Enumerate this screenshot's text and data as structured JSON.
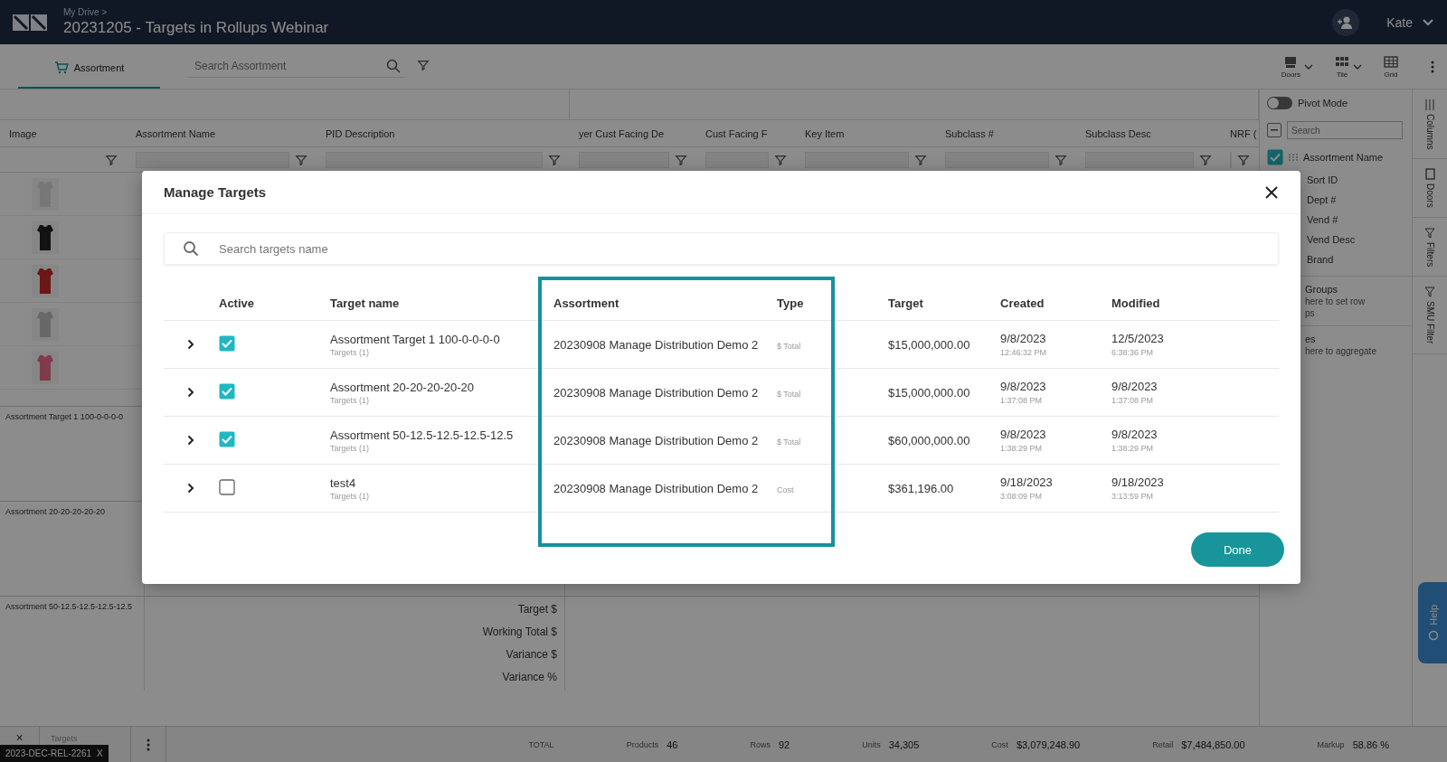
{
  "app": {
    "breadcrumb": "My Drive >",
    "title": "20231205 - Targets in Rollups Webinar",
    "user": "Kate"
  },
  "toolbar": {
    "tab": "Assortment",
    "search_placeholder": "Search Assortment",
    "views": [
      "Doors",
      "Tile",
      "Grid"
    ]
  },
  "grid": {
    "columns": [
      "Image",
      "Assortment Name",
      "PID Description",
      "yer Cust Facing De",
      "Cust Facing F",
      "Key Item",
      "Subclass #",
      "Subclass Desc",
      "NRF ("
    ],
    "rollups": [
      {
        "name": "Assortment Target 1 100-0-0-0-0"
      },
      {
        "name": "Assortment 20-20-20-20-20"
      },
      {
        "name": "Assortment 50-12.5-12.5-12.5-12.5",
        "metrics": [
          "Target $",
          "Working Total $",
          "Variance $",
          "Variance %"
        ]
      }
    ]
  },
  "side_panel": {
    "pivot_mode": {
      "label": "Pivot Mode",
      "on": false
    },
    "search_placeholder": "Search",
    "first_column": {
      "label": "Assortment Name",
      "checked": true
    },
    "more_columns": [
      "Sort ID",
      "Dept #",
      "Vend #",
      "Vend Desc",
      "Brand"
    ],
    "row_groups": {
      "title": "Groups",
      "hint": "here to set row",
      "hint_2": "ps"
    },
    "values": {
      "title": "es",
      "hint": "here to aggregate"
    },
    "tabs": [
      "Columns",
      "Doors",
      "Filters",
      "SMU Filter"
    ],
    "help": "Help"
  },
  "status_bar": {
    "close": "×",
    "tab": "Targets",
    "version": "2023-DEC-REL-2261",
    "version_close": "X",
    "stats": [
      {
        "label": "TOTAL"
      },
      {
        "label": "Products",
        "value": "46"
      },
      {
        "label": "Rows",
        "value": "92"
      },
      {
        "label": "Units",
        "value": "34,305"
      },
      {
        "label": "Cost",
        "value": "$3,079,248.90"
      },
      {
        "label": "Retail",
        "value": "$7,484,850.00"
      },
      {
        "label": "Markup",
        "value": "58.86 %"
      }
    ]
  },
  "modal": {
    "title": "Manage Targets",
    "search_placeholder": "Search targets name",
    "columns": [
      "Active",
      "Target name",
      "Assortment",
      "Type",
      "Target",
      "Created",
      "Modified"
    ],
    "rows": [
      {
        "active": true,
        "name": "Assortment Target 1 100-0-0-0-0",
        "sub": "Targets (1)",
        "assortment": "20230908 Manage Distribution Demo 2",
        "type": "$ Total",
        "target": "$15,000,000.00",
        "created": "9/8/2023",
        "created_time": "12:46:32 PM",
        "modified": "12/5/2023",
        "modified_time": "6:38:36 PM"
      },
      {
        "active": true,
        "name": "Assortment 20-20-20-20-20",
        "sub": "Targets (1)",
        "assortment": "20230908 Manage Distribution Demo 2",
        "type": "$ Total",
        "target": "$15,000,000.00",
        "created": "9/8/2023",
        "created_time": "1:37:08 PM",
        "modified": "9/8/2023",
        "modified_time": "1:37:08 PM"
      },
      {
        "active": true,
        "name": "Assortment 50-12.5-12.5-12.5-12.5",
        "sub": "Targets (1)",
        "assortment": "20230908 Manage Distribution Demo 2",
        "type": "$ Total",
        "target": "$60,000,000.00",
        "created": "9/8/2023",
        "created_time": "1:38:29 PM",
        "modified": "9/8/2023",
        "modified_time": "1:38:29 PM"
      },
      {
        "active": false,
        "name": "test4",
        "sub": "Targets (1)",
        "assortment": "20230908 Manage Distribution Demo 2",
        "type": "Cost",
        "target": "$361,196.00",
        "created": "9/18/2023",
        "created_time": "3:08:09 PM",
        "modified": "9/18/2023",
        "modified_time": "3:13:59 PM"
      }
    ],
    "done": "Done"
  }
}
